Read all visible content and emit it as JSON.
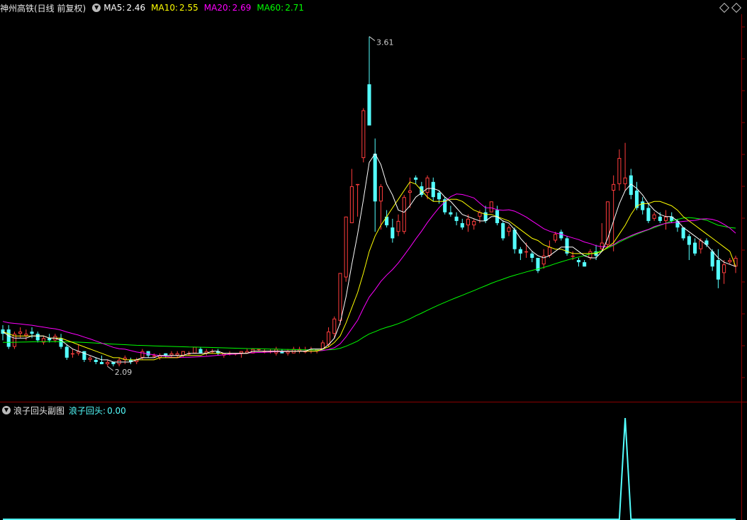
{
  "main_header": {
    "title": "神州高铁(日线 前复权)",
    "ma5_label": "MA5:",
    "ma5_value": "2.46",
    "ma10_label": "MA10:",
    "ma10_value": "2.55",
    "ma20_label": "MA20:",
    "ma20_value": "2.69",
    "ma60_label": "MA60:",
    "ma60_value": "2.71"
  },
  "sub_header": {
    "title": "浪子回头副图",
    "indicator_label": "浪子回头:",
    "indicator_value": "0.00"
  },
  "colors": {
    "up": "#ff3c3c",
    "down": "#54ffff",
    "ma5": "#ffffff",
    "ma10": "#ffff00",
    "ma20": "#ff00ff",
    "ma60": "#00ff00",
    "grid": "#8b0000",
    "indicator": "#54ffff"
  },
  "icons": [
    "collapse-icon",
    "diamond-icon"
  ],
  "chart_data": [
    {
      "type": "candlestick",
      "title": "神州高铁(日线 前复权)",
      "price_range": [
        1.95,
        3.7
      ],
      "annotations": [
        {
          "text": "3.61",
          "value": 3.61,
          "index": 63
        },
        {
          "text": "2.09",
          "value": 2.09,
          "index": 18
        }
      ],
      "candles": [
        [
          2.26,
          2.28,
          2.21,
          2.24
        ],
        [
          2.26,
          2.28,
          2.17,
          2.18
        ],
        [
          2.18,
          2.25,
          2.17,
          2.24
        ],
        [
          2.24,
          2.27,
          2.22,
          2.25
        ],
        [
          2.23,
          2.26,
          2.21,
          2.24
        ],
        [
          2.25,
          2.27,
          2.22,
          2.24
        ],
        [
          2.24,
          2.25,
          2.2,
          2.21
        ],
        [
          2.2,
          2.23,
          2.19,
          2.22
        ],
        [
          2.22,
          2.24,
          2.2,
          2.21
        ],
        [
          2.21,
          2.24,
          2.2,
          2.23
        ],
        [
          2.22,
          2.24,
          2.17,
          2.18
        ],
        [
          2.18,
          2.19,
          2.12,
          2.13
        ],
        [
          2.15,
          2.17,
          2.13,
          2.15
        ],
        [
          2.15,
          2.19,
          2.14,
          2.16
        ],
        [
          2.16,
          2.16,
          2.11,
          2.12
        ],
        [
          2.12,
          2.14,
          2.11,
          2.13
        ],
        [
          2.12,
          2.13,
          2.1,
          2.11
        ],
        [
          2.11,
          2.14,
          2.1,
          2.1
        ],
        [
          2.1,
          2.12,
          2.09,
          2.11
        ],
        [
          2.11,
          2.11,
          2.09,
          2.1
        ],
        [
          2.1,
          2.13,
          2.09,
          2.12
        ],
        [
          2.12,
          2.14,
          2.1,
          2.13
        ],
        [
          2.12,
          2.13,
          2.1,
          2.11
        ],
        [
          2.11,
          2.13,
          2.1,
          2.12
        ],
        [
          2.13,
          2.17,
          2.12,
          2.16
        ],
        [
          2.16,
          2.16,
          2.13,
          2.14
        ],
        [
          2.14,
          2.15,
          2.13,
          2.14
        ],
        [
          2.13,
          2.15,
          2.12,
          2.14
        ],
        [
          2.15,
          2.15,
          2.13,
          2.14
        ],
        [
          2.14,
          2.16,
          2.13,
          2.15
        ],
        [
          2.14,
          2.16,
          2.13,
          2.15
        ],
        [
          2.14,
          2.16,
          2.13,
          2.16
        ],
        [
          2.15,
          2.16,
          2.14,
          2.15
        ],
        [
          2.15,
          2.18,
          2.15,
          2.18
        ],
        [
          2.17,
          2.18,
          2.15,
          2.15
        ],
        [
          2.15,
          2.17,
          2.14,
          2.16
        ],
        [
          2.16,
          2.17,
          2.15,
          2.16
        ],
        [
          2.16,
          2.17,
          2.14,
          2.15
        ],
        [
          2.14,
          2.15,
          2.13,
          2.15
        ],
        [
          2.15,
          2.16,
          2.14,
          2.15
        ],
        [
          2.15,
          2.15,
          2.14,
          2.15
        ],
        [
          2.15,
          2.16,
          2.13,
          2.16
        ],
        [
          2.15,
          2.17,
          2.15,
          2.16
        ],
        [
          2.15,
          2.17,
          2.15,
          2.17
        ],
        [
          2.17,
          2.17,
          2.16,
          2.17
        ],
        [
          2.16,
          2.17,
          2.15,
          2.16
        ],
        [
          2.16,
          2.17,
          2.15,
          2.16
        ],
        [
          2.15,
          2.18,
          2.14,
          2.17
        ],
        [
          2.16,
          2.17,
          2.15,
          2.15
        ],
        [
          2.15,
          2.17,
          2.14,
          2.16
        ],
        [
          2.15,
          2.18,
          2.15,
          2.17
        ],
        [
          2.16,
          2.18,
          2.15,
          2.17
        ],
        [
          2.16,
          2.18,
          2.15,
          2.16
        ],
        [
          2.17,
          2.18,
          2.15,
          2.17
        ],
        [
          2.16,
          2.17,
          2.15,
          2.17
        ],
        [
          2.17,
          2.21,
          2.17,
          2.2
        ],
        [
          2.19,
          2.27,
          2.18,
          2.25
        ],
        [
          2.24,
          2.32,
          2.22,
          2.31
        ],
        [
          2.3,
          2.52,
          2.28,
          2.52
        ],
        [
          2.5,
          2.78,
          2.48,
          2.78
        ],
        [
          2.75,
          3.0,
          2.75,
          2.92
        ],
        [
          2.93,
          2.93,
          2.78,
          2.93
        ],
        [
          3.05,
          3.28,
          3.03,
          3.27
        ],
        [
          3.39,
          3.61,
          3.22,
          3.2
        ],
        [
          3.07,
          3.14,
          2.71,
          2.85
        ],
        [
          2.85,
          2.93,
          2.72,
          2.92
        ],
        [
          2.78,
          2.81,
          2.73,
          2.74
        ],
        [
          2.73,
          2.77,
          2.66,
          2.68
        ],
        [
          2.71,
          2.79,
          2.69,
          2.76
        ],
        [
          2.71,
          2.88,
          2.7,
          2.87
        ],
        [
          2.89,
          2.96,
          2.82,
          2.9
        ],
        [
          2.96,
          2.97,
          2.93,
          2.95
        ],
        [
          2.92,
          2.94,
          2.87,
          2.88
        ],
        [
          2.89,
          2.97,
          2.86,
          2.96
        ],
        [
          2.94,
          2.96,
          2.85,
          2.87
        ],
        [
          2.89,
          2.9,
          2.84,
          2.86
        ],
        [
          2.86,
          2.87,
          2.79,
          2.8
        ],
        [
          2.8,
          2.83,
          2.78,
          2.79
        ],
        [
          2.78,
          2.8,
          2.74,
          2.76
        ],
        [
          2.75,
          2.77,
          2.72,
          2.73
        ],
        [
          2.74,
          2.79,
          2.71,
          2.77
        ],
        [
          2.74,
          2.77,
          2.72,
          2.76
        ],
        [
          2.78,
          2.81,
          2.75,
          2.8
        ],
        [
          2.8,
          2.83,
          2.75,
          2.76
        ],
        [
          2.8,
          2.85,
          2.8,
          2.85
        ],
        [
          2.81,
          2.83,
          2.74,
          2.75
        ],
        [
          2.75,
          2.76,
          2.67,
          2.68
        ],
        [
          2.71,
          2.74,
          2.69,
          2.73
        ],
        [
          2.72,
          2.73,
          2.61,
          2.63
        ],
        [
          2.63,
          2.64,
          2.58,
          2.61
        ],
        [
          2.62,
          2.66,
          2.59,
          2.62
        ],
        [
          2.61,
          2.62,
          2.57,
          2.59
        ],
        [
          2.59,
          2.59,
          2.52,
          2.53
        ],
        [
          2.56,
          2.63,
          2.54,
          2.6
        ],
        [
          2.6,
          2.67,
          2.59,
          2.64
        ],
        [
          2.67,
          2.71,
          2.66,
          2.7
        ],
        [
          2.71,
          2.72,
          2.67,
          2.68
        ],
        [
          2.68,
          2.69,
          2.6,
          2.61
        ],
        [
          2.6,
          2.62,
          2.58,
          2.6
        ],
        [
          2.58,
          2.59,
          2.55,
          2.57
        ],
        [
          2.57,
          2.58,
          2.55,
          2.55
        ],
        [
          2.59,
          2.63,
          2.58,
          2.62
        ],
        [
          2.62,
          2.65,
          2.58,
          2.6
        ],
        [
          2.63,
          2.75,
          2.62,
          2.66
        ],
        [
          2.65,
          2.85,
          2.64,
          2.85
        ],
        [
          2.9,
          2.97,
          2.62,
          2.93
        ],
        [
          2.93,
          3.09,
          2.9,
          3.05
        ],
        [
          2.93,
          3.12,
          2.9,
          2.96
        ],
        [
          2.97,
          3.0,
          2.86,
          2.88
        ],
        [
          2.9,
          2.94,
          2.81,
          2.82
        ],
        [
          2.85,
          2.87,
          2.79,
          2.81
        ],
        [
          2.82,
          2.84,
          2.75,
          2.76
        ],
        [
          2.77,
          2.8,
          2.76,
          2.79
        ],
        [
          2.78,
          2.8,
          2.75,
          2.76
        ],
        [
          2.76,
          2.81,
          2.72,
          2.78
        ],
        [
          2.78,
          2.8,
          2.75,
          2.76
        ],
        [
          2.76,
          2.77,
          2.71,
          2.73
        ],
        [
          2.73,
          2.73,
          2.67,
          2.68
        ],
        [
          2.69,
          2.7,
          2.58,
          2.65
        ],
        [
          2.66,
          2.68,
          2.6,
          2.61
        ],
        [
          2.63,
          2.68,
          2.61,
          2.67
        ],
        [
          2.67,
          2.68,
          2.64,
          2.65
        ],
        [
          2.62,
          2.63,
          2.53,
          2.55
        ],
        [
          2.58,
          2.63,
          2.45,
          2.49
        ],
        [
          2.52,
          2.58,
          2.47,
          2.56
        ],
        [
          2.57,
          2.59,
          2.56,
          2.58
        ],
        [
          2.55,
          2.6,
          2.52,
          2.59
        ]
      ],
      "ma5": [
        2.25,
        2.23,
        2.22,
        2.22,
        2.22,
        2.23,
        2.23,
        2.23,
        2.22,
        2.22,
        2.21,
        2.19,
        2.17,
        2.16,
        2.15,
        2.14,
        2.13,
        2.12,
        2.12,
        2.11,
        2.11,
        2.11,
        2.11,
        2.12,
        2.13,
        2.13,
        2.13,
        2.14,
        2.14,
        2.14,
        2.14,
        2.14,
        2.15,
        2.15,
        2.15,
        2.15,
        2.16,
        2.16,
        2.15,
        2.15,
        2.15,
        2.15,
        2.15,
        2.16,
        2.16,
        2.16,
        2.16,
        2.16,
        2.16,
        2.16,
        2.16,
        2.16,
        2.16,
        2.17,
        2.17,
        2.17,
        2.19,
        2.22,
        2.29,
        2.41,
        2.56,
        2.7,
        2.86,
        3.03,
        3.07,
        3.02,
        2.93,
        2.88,
        2.81,
        2.8,
        2.83,
        2.87,
        2.89,
        2.91,
        2.91,
        2.9,
        2.87,
        2.85,
        2.82,
        2.79,
        2.78,
        2.77,
        2.76,
        2.76,
        2.78,
        2.78,
        2.76,
        2.75,
        2.72,
        2.68,
        2.65,
        2.62,
        2.6,
        2.59,
        2.6,
        2.62,
        2.64,
        2.64,
        2.64,
        2.62,
        2.6,
        2.59,
        2.59,
        2.62,
        2.68,
        2.76,
        2.84,
        2.9,
        2.93,
        2.91,
        2.88,
        2.84,
        2.81,
        2.79,
        2.78,
        2.78,
        2.76,
        2.73,
        2.71,
        2.69,
        2.67,
        2.65,
        2.62,
        2.59,
        2.57,
        2.56,
        2.55
      ],
      "ma10": [
        2.25,
        2.24,
        2.23,
        2.23,
        2.23,
        2.23,
        2.23,
        2.23,
        2.22,
        2.22,
        2.22,
        2.21,
        2.2,
        2.19,
        2.18,
        2.17,
        2.16,
        2.15,
        2.14,
        2.13,
        2.13,
        2.12,
        2.12,
        2.12,
        2.12,
        2.12,
        2.12,
        2.13,
        2.13,
        2.13,
        2.13,
        2.14,
        2.14,
        2.14,
        2.14,
        2.15,
        2.15,
        2.15,
        2.15,
        2.15,
        2.15,
        2.15,
        2.15,
        2.16,
        2.16,
        2.16,
        2.16,
        2.16,
        2.16,
        2.16,
        2.16,
        2.16,
        2.16,
        2.16,
        2.16,
        2.17,
        2.18,
        2.2,
        2.23,
        2.29,
        2.36,
        2.43,
        2.52,
        2.62,
        2.69,
        2.74,
        2.78,
        2.82,
        2.86,
        2.9,
        2.94,
        2.93,
        2.9,
        2.87,
        2.85,
        2.85,
        2.85,
        2.86,
        2.86,
        2.85,
        2.83,
        2.81,
        2.8,
        2.79,
        2.79,
        2.78,
        2.77,
        2.76,
        2.74,
        2.72,
        2.7,
        2.68,
        2.67,
        2.65,
        2.64,
        2.63,
        2.63,
        2.62,
        2.61,
        2.61,
        2.61,
        2.61,
        2.61,
        2.62,
        2.64,
        2.66,
        2.7,
        2.74,
        2.79,
        2.83,
        2.84,
        2.84,
        2.85,
        2.85,
        2.84,
        2.83,
        2.81,
        2.78,
        2.76,
        2.74,
        2.72,
        2.7,
        2.68,
        2.66,
        2.64,
        2.62,
        2.55
      ]
    },
    {
      "type": "line",
      "title": "浪子回头副图",
      "series": [
        {
          "name": "浪子回头",
          "spike_index": 107,
          "spike_value": 1,
          "baseline": 0
        }
      ]
    }
  ]
}
